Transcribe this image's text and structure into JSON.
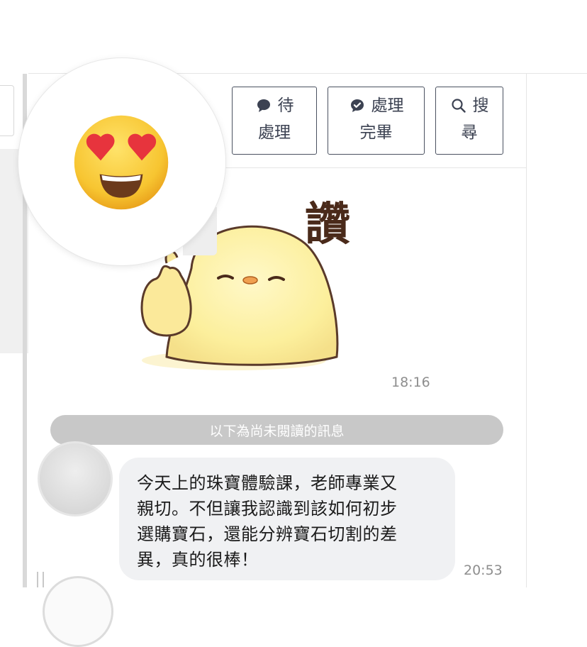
{
  "toolbar": {
    "pending_label": [
      "待",
      "處理"
    ],
    "done_label": [
      "處理",
      "完畢"
    ],
    "search_label": [
      "搜",
      "尋"
    ],
    "pending_icon": "speech-bubble-icon",
    "done_icon": "check-bubble-icon",
    "search_icon": "search-icon"
  },
  "conversation": {
    "sticker": {
      "text": "讚",
      "icon": "thumbs-up-chick-sticker",
      "time": "18:16"
    },
    "unread_divider": "以下為尚未閱讀的訊息",
    "messages": [
      {
        "lines": [
          "今天上的珠寶體驗課，老師專業又",
          "親切。不但讓我認識到該如何初步",
          "選購寶石，還能分辨寶石切割的差",
          "異，真的很棒！"
        ],
        "time": "20:53"
      }
    ]
  },
  "magnifier": {
    "emoji": "heart-eyes-emoji-icon"
  },
  "colors": {
    "button_border": "#4a5160",
    "bubble_bg": "#f0f1f3",
    "divider_bar": "#c8c8c8",
    "timestamp": "#8e8e8e"
  }
}
